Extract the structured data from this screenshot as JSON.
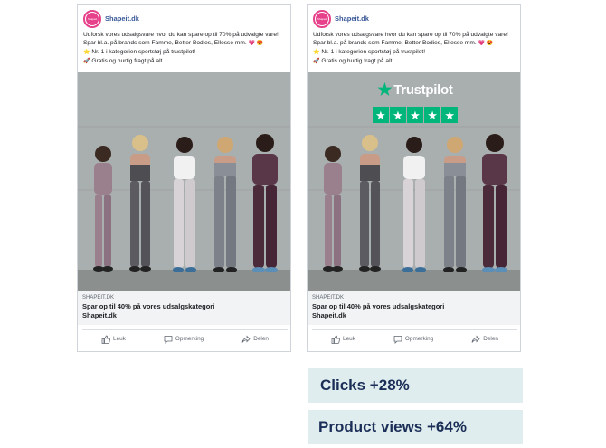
{
  "cards": [
    {
      "page_name": "Shapeit.dk",
      "avatar_text": "Shapeit",
      "body_line1": "Udforsk vores udsalgsvare hvor du kan spare op til 70% på udvalgte vare!",
      "body_line2": "Spar bl.a. på brands som Famme, Better Bodies, Ellesse mm.",
      "body_line2_emoji": "💗 😍",
      "body_line3_emoji": "⭐",
      "body_line3": "Nr. 1 i kategorien sportstøj på trustpilot!",
      "body_line4_emoji": "🚀",
      "body_line4": "Gratis og hurtig fragt på alt",
      "link_domain": "SHAPEIT.DK",
      "link_headline": "Spar op til 40% på vores udsalgskategori",
      "link_sub": "Shapeit.dk",
      "like_label": "Leuk",
      "comment_label": "Opmerking",
      "share_label": "Delen"
    },
    {
      "page_name": "Shapeit.dk",
      "avatar_text": "Shapeit",
      "body_line1": "Udforsk vores udsalgsvare hvor du kan spare op til 70% på udvalgte vare!",
      "body_line2": "Spar bl.a. på brands som Famme, Better Bodies, Ellesse mm.",
      "body_line2_emoji": "💗 😍",
      "body_line3_emoji": "⭐",
      "body_line3": "Nr. 1 i kategorien sportstøj på trustpilot!",
      "body_line4_emoji": "🚀",
      "body_line4": "Gratis og hurtig fragt på alt",
      "trustpilot_label": "Trustpilot",
      "trustpilot_rating": 5,
      "link_domain": "SHAPEIT.DK",
      "link_headline": "Spar op til 40% på vores udsalgskategori",
      "link_sub": "Shapeit.dk",
      "like_label": "Leuk",
      "comment_label": "Opmerking",
      "share_label": "Delen"
    }
  ],
  "stats": {
    "clicks": "Clicks +28%",
    "views": "Product views +64%"
  },
  "colors": {
    "brand_pink": "#e6418a",
    "trustpilot_green": "#00b67a",
    "stat_bg": "#e0edee",
    "stat_text": "#1a2e57"
  },
  "icons": {
    "like": "thumbs-up-icon",
    "comment": "comment-icon",
    "share": "share-arrow-icon",
    "trustpilot_star": "star-icon"
  }
}
